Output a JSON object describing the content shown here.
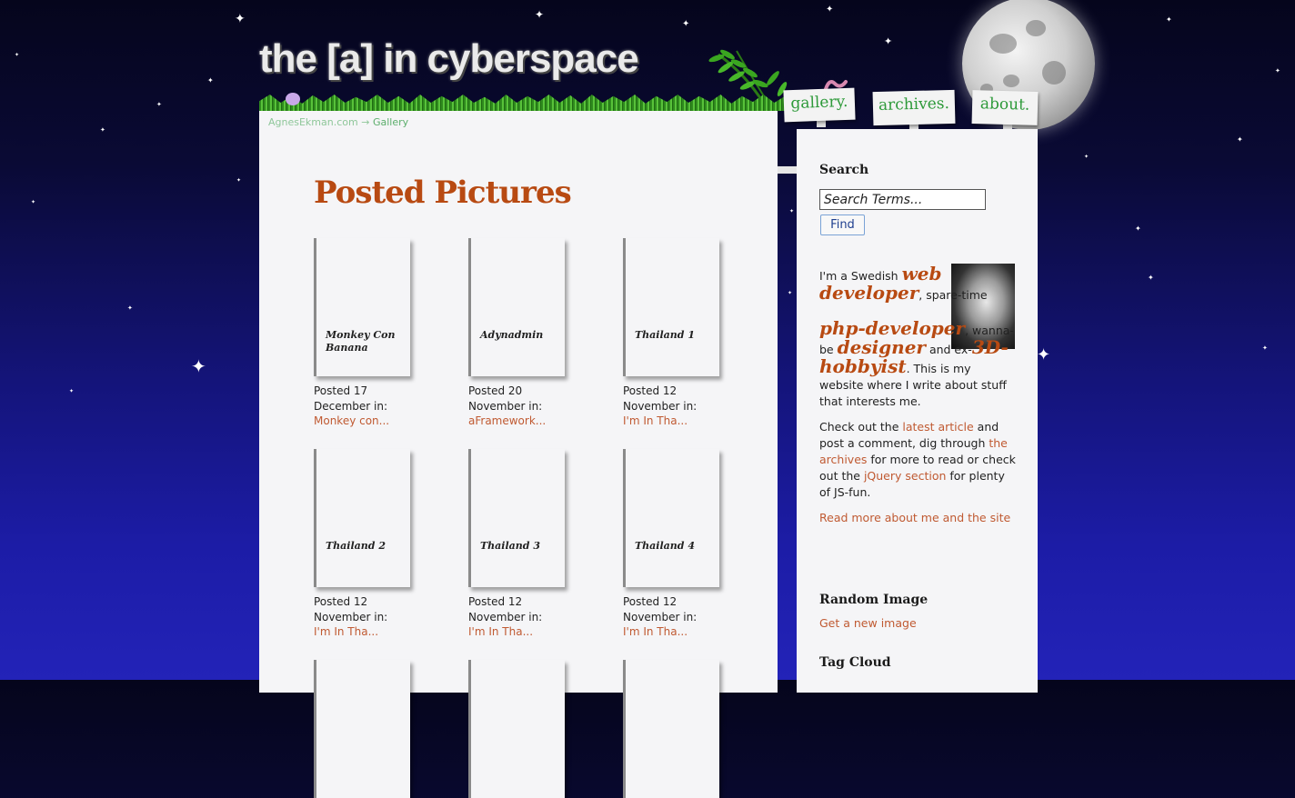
{
  "header": {
    "logo": "the [a] in cyberspace",
    "nav": [
      "gallery.",
      "archives.",
      "about."
    ]
  },
  "breadcrumb": {
    "home": "AgnesEkman.com",
    "arrow": "→",
    "current": "Gallery"
  },
  "main": {
    "title": "Posted Pictures",
    "cards": [
      {
        "title": "Monkey Con Banana",
        "posted": "Posted 17",
        "date": "December in:",
        "category": "Monkey con..."
      },
      {
        "title": "Adynadmin",
        "posted": "Posted 20",
        "date": "November in:",
        "category": "aFramework..."
      },
      {
        "title": "Thailand 1",
        "posted": "Posted 12",
        "date": "November in:",
        "category": "I'm In Tha..."
      },
      {
        "title": "Thailand 2",
        "posted": "Posted 12",
        "date": "November in:",
        "category": "I'm In Tha..."
      },
      {
        "title": "Thailand 3",
        "posted": "Posted 12",
        "date": "November in:",
        "category": "I'm In Tha..."
      },
      {
        "title": "Thailand 4",
        "posted": "Posted 12",
        "date": "November in:",
        "category": "I'm In Tha..."
      }
    ]
  },
  "sidebar": {
    "search_heading": "Search",
    "search_placeholder": "Search Terms...",
    "find_label": "Find",
    "bio": {
      "p1_a": "I'm a Swedish ",
      "web_developer": "web developer",
      "p1_b": ", spare-time ",
      "php_developer": "php-developer",
      "p1_c": ", wanna-be ",
      "designer": "designer",
      "p1_d": " and ex-",
      "hobbyist": "3D-hobbyist",
      "p1_e": ". This is my website where I write about stuff that interests me.",
      "p2_a": "Check out the ",
      "latest_article": "latest article",
      "p2_b": " and post a comment, dig through ",
      "the_archives": "the archives",
      "p2_c": " for more to read or check out the ",
      "jquery_section": "jQuery section",
      "p2_d": " for plenty of JS-fun.",
      "read_more": "Read more about me and the site"
    },
    "random_heading": "Random Image",
    "new_image": "Get a new image",
    "tag_heading": "Tag Cloud"
  }
}
